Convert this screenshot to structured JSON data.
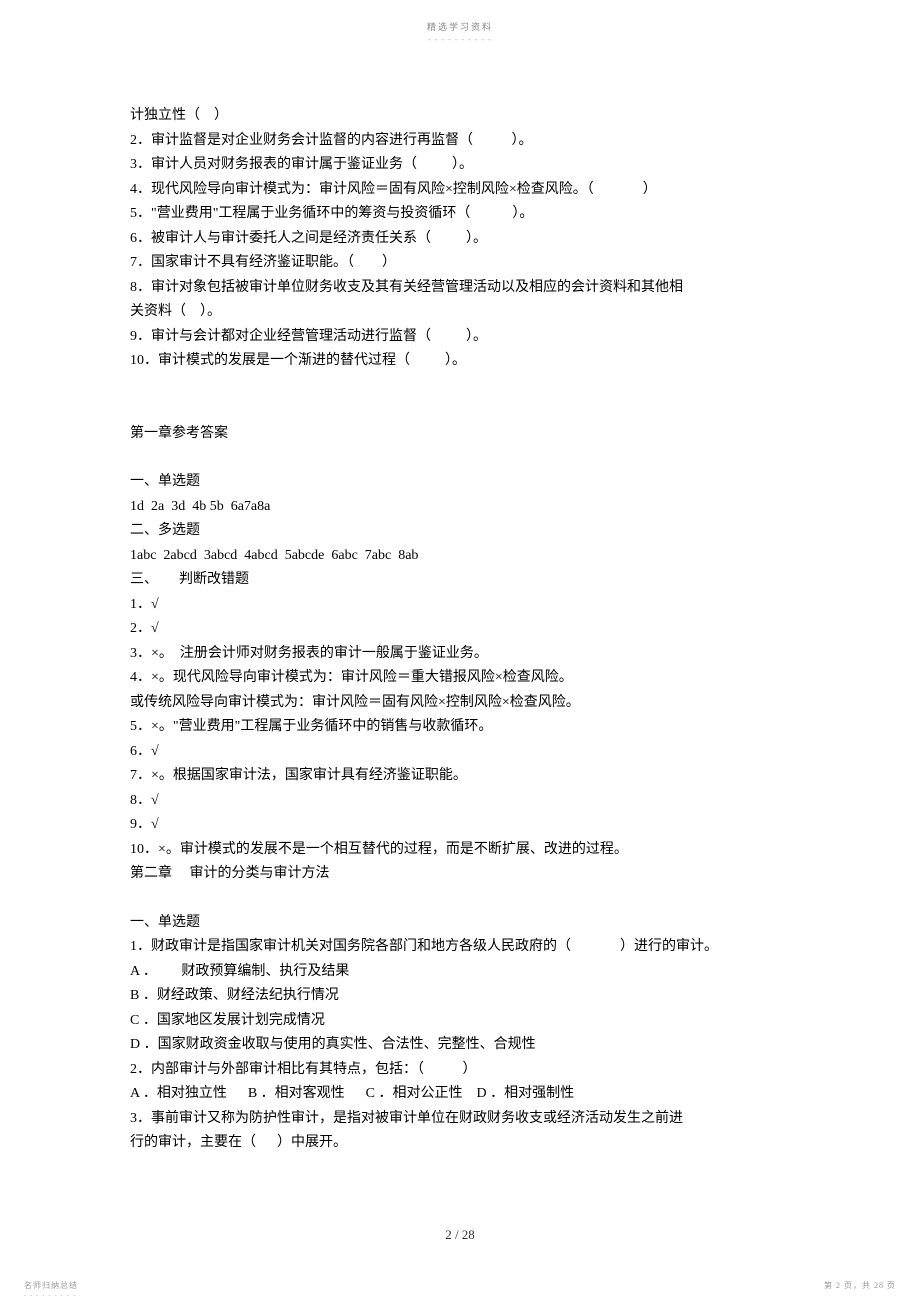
{
  "header": {
    "top_label": "精选学习资料",
    "top_dashes": "- - - - - - - - - -"
  },
  "body": {
    "lines": [
      "计独立性（    ）",
      "2．审计监督是对企业财务会计监督的内容进行再监督（           ）。",
      "3．审计人员对财务报表的审计属于鉴证业务（          ）。",
      "4．现代风险导向审计模式为：审计风险＝固有风险×控制风险×检查风险。（              ）",
      "5．\"营业费用\"工程属于业务循环中的筹资与投资循环（            ）。",
      "6．被审计人与审计委托人之间是经济责任关系（          ）。",
      "7．国家审计不具有经济鉴证职能。（        ）",
      "8．审计对象包括被审计单位财务收支及其有关经营管理活动以及相应的会计资料和其他相",
      "关资料（    ）。",
      "9．审计与会计都对企业经营管理活动进行监督（          ）。",
      "10．审计模式的发展是一个渐进的替代过程（          ）。"
    ],
    "answers_title": "第一章参考答案",
    "section_single_title": "一、单选题",
    "single_answers": "1d  2a  3d  4b 5b  6a7a8a",
    "section_multi_title": "二、多选题",
    "multi_answers": "1abc  2abcd  3abcd  4abcd  5abcde  6abc  7abc  8ab",
    "section_judge_title": "三、      判断改错题",
    "judge_lines": [
      "1．√",
      "2．√",
      "3．×。  注册会计师对财务报表的审计一般属于鉴证业务。",
      "4．×。现代风险导向审计模式为：审计风险＝重大错报风险×检查风险。",
      "或传统风险导向审计模式为：审计风险＝固有风险×控制风险×检查风险。",
      "5．×。\"营业费用\"工程属于业务循环中的销售与收款循环。",
      "6．√",
      "7．×。根据国家审计法，国家审计具有经济鉴证职能。",
      "8．√",
      "9．√",
      "10．×。审计模式的发展不是一个相互替代的过程，而是不断扩展、改进的过程。"
    ],
    "chapter2_title": "第二章     审计的分类与审计方法",
    "ch2_single_title": "一、单选题",
    "ch2_lines": [
      "1．财政审计是指国家审计机关对国务院各部门和地方各级人民政府的（              ）进行的审计。",
      "A ．       财政预算编制、执行及结果",
      "B ．财经政策、财经法纪执行情况",
      "C ．国家地区发展计划完成情况",
      "D ．国家财政资金收取与使用的真实性、合法性、完整性、合规性",
      "2．内部审计与外部审计相比有其特点，包括：（           ）",
      "A ．相对独立性      B ．相对客观性      C ．相对公正性    D ．相对强制性",
      "3．事前审计又称为防护性审计，是指对被审计单位在财政财务收支或经济活动发生之前进",
      "行的审计，主要在（      ）中展开。"
    ]
  },
  "footer": {
    "page_num": "2 / 28",
    "left_label": "名师归纳总结",
    "left_dashes": "- - - - - - - - -",
    "right_label": "第 2 页，共 28 页"
  }
}
